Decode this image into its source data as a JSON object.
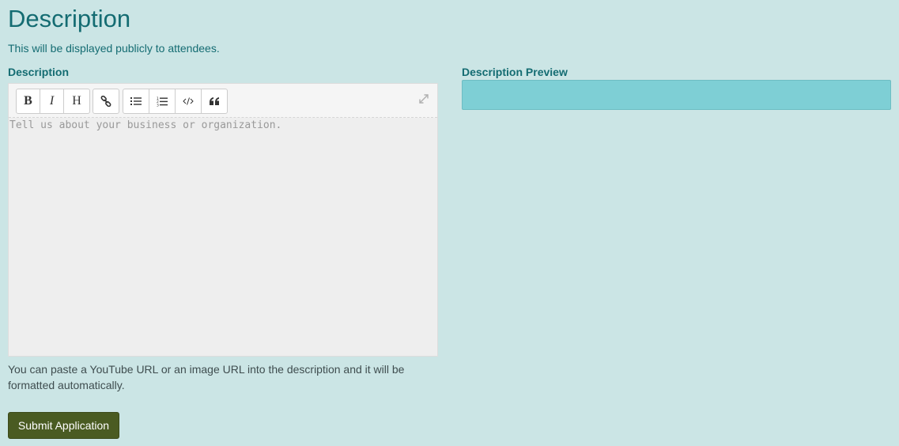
{
  "header": {
    "title": "Description",
    "subtitle": "This will be displayed publicly to attendees."
  },
  "description_field": {
    "label": "Description",
    "placeholder": "Tell us about your business or organization.",
    "value": "",
    "toolbar": {
      "bold": "B",
      "italic": "I",
      "heading": "H",
      "icons": [
        "link-icon",
        "unordered-list-icon",
        "ordered-list-icon",
        "code-icon",
        "quote-icon",
        "fullscreen-icon"
      ]
    },
    "help_text": "You can paste a YouTube URL or an image URL into the description and it will be formatted automatically."
  },
  "preview": {
    "label": "Description Preview",
    "content": ""
  },
  "submit": {
    "label": "Submit Application"
  },
  "colors": {
    "background": "#cbe5e5",
    "heading": "#146c72",
    "preview_fill": "#7ecfd5",
    "submit_button": "#4a5b22"
  }
}
